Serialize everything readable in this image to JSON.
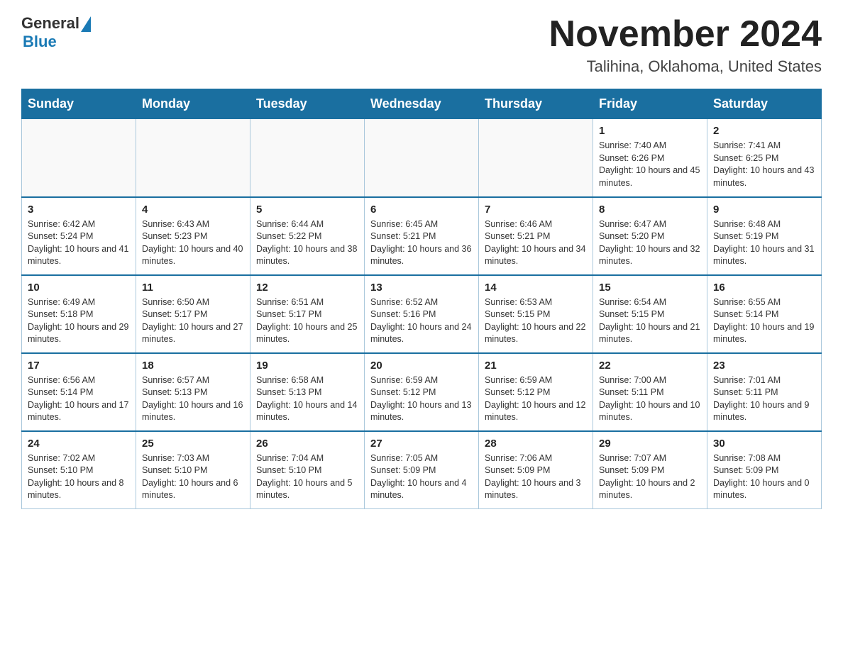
{
  "logo": {
    "general": "General",
    "blue": "Blue"
  },
  "header": {
    "month_year": "November 2024",
    "location": "Talihina, Oklahoma, United States"
  },
  "weekdays": [
    "Sunday",
    "Monday",
    "Tuesday",
    "Wednesday",
    "Thursday",
    "Friday",
    "Saturday"
  ],
  "weeks": [
    [
      {
        "day": "",
        "info": ""
      },
      {
        "day": "",
        "info": ""
      },
      {
        "day": "",
        "info": ""
      },
      {
        "day": "",
        "info": ""
      },
      {
        "day": "",
        "info": ""
      },
      {
        "day": "1",
        "info": "Sunrise: 7:40 AM\nSunset: 6:26 PM\nDaylight: 10 hours and 45 minutes."
      },
      {
        "day": "2",
        "info": "Sunrise: 7:41 AM\nSunset: 6:25 PM\nDaylight: 10 hours and 43 minutes."
      }
    ],
    [
      {
        "day": "3",
        "info": "Sunrise: 6:42 AM\nSunset: 5:24 PM\nDaylight: 10 hours and 41 minutes."
      },
      {
        "day": "4",
        "info": "Sunrise: 6:43 AM\nSunset: 5:23 PM\nDaylight: 10 hours and 40 minutes."
      },
      {
        "day": "5",
        "info": "Sunrise: 6:44 AM\nSunset: 5:22 PM\nDaylight: 10 hours and 38 minutes."
      },
      {
        "day": "6",
        "info": "Sunrise: 6:45 AM\nSunset: 5:21 PM\nDaylight: 10 hours and 36 minutes."
      },
      {
        "day": "7",
        "info": "Sunrise: 6:46 AM\nSunset: 5:21 PM\nDaylight: 10 hours and 34 minutes."
      },
      {
        "day": "8",
        "info": "Sunrise: 6:47 AM\nSunset: 5:20 PM\nDaylight: 10 hours and 32 minutes."
      },
      {
        "day": "9",
        "info": "Sunrise: 6:48 AM\nSunset: 5:19 PM\nDaylight: 10 hours and 31 minutes."
      }
    ],
    [
      {
        "day": "10",
        "info": "Sunrise: 6:49 AM\nSunset: 5:18 PM\nDaylight: 10 hours and 29 minutes."
      },
      {
        "day": "11",
        "info": "Sunrise: 6:50 AM\nSunset: 5:17 PM\nDaylight: 10 hours and 27 minutes."
      },
      {
        "day": "12",
        "info": "Sunrise: 6:51 AM\nSunset: 5:17 PM\nDaylight: 10 hours and 25 minutes."
      },
      {
        "day": "13",
        "info": "Sunrise: 6:52 AM\nSunset: 5:16 PM\nDaylight: 10 hours and 24 minutes."
      },
      {
        "day": "14",
        "info": "Sunrise: 6:53 AM\nSunset: 5:15 PM\nDaylight: 10 hours and 22 minutes."
      },
      {
        "day": "15",
        "info": "Sunrise: 6:54 AM\nSunset: 5:15 PM\nDaylight: 10 hours and 21 minutes."
      },
      {
        "day": "16",
        "info": "Sunrise: 6:55 AM\nSunset: 5:14 PM\nDaylight: 10 hours and 19 minutes."
      }
    ],
    [
      {
        "day": "17",
        "info": "Sunrise: 6:56 AM\nSunset: 5:14 PM\nDaylight: 10 hours and 17 minutes."
      },
      {
        "day": "18",
        "info": "Sunrise: 6:57 AM\nSunset: 5:13 PM\nDaylight: 10 hours and 16 minutes."
      },
      {
        "day": "19",
        "info": "Sunrise: 6:58 AM\nSunset: 5:13 PM\nDaylight: 10 hours and 14 minutes."
      },
      {
        "day": "20",
        "info": "Sunrise: 6:59 AM\nSunset: 5:12 PM\nDaylight: 10 hours and 13 minutes."
      },
      {
        "day": "21",
        "info": "Sunrise: 6:59 AM\nSunset: 5:12 PM\nDaylight: 10 hours and 12 minutes."
      },
      {
        "day": "22",
        "info": "Sunrise: 7:00 AM\nSunset: 5:11 PM\nDaylight: 10 hours and 10 minutes."
      },
      {
        "day": "23",
        "info": "Sunrise: 7:01 AM\nSunset: 5:11 PM\nDaylight: 10 hours and 9 minutes."
      }
    ],
    [
      {
        "day": "24",
        "info": "Sunrise: 7:02 AM\nSunset: 5:10 PM\nDaylight: 10 hours and 8 minutes."
      },
      {
        "day": "25",
        "info": "Sunrise: 7:03 AM\nSunset: 5:10 PM\nDaylight: 10 hours and 6 minutes."
      },
      {
        "day": "26",
        "info": "Sunrise: 7:04 AM\nSunset: 5:10 PM\nDaylight: 10 hours and 5 minutes."
      },
      {
        "day": "27",
        "info": "Sunrise: 7:05 AM\nSunset: 5:09 PM\nDaylight: 10 hours and 4 minutes."
      },
      {
        "day": "28",
        "info": "Sunrise: 7:06 AM\nSunset: 5:09 PM\nDaylight: 10 hours and 3 minutes."
      },
      {
        "day": "29",
        "info": "Sunrise: 7:07 AM\nSunset: 5:09 PM\nDaylight: 10 hours and 2 minutes."
      },
      {
        "day": "30",
        "info": "Sunrise: 7:08 AM\nSunset: 5:09 PM\nDaylight: 10 hours and 0 minutes."
      }
    ]
  ]
}
